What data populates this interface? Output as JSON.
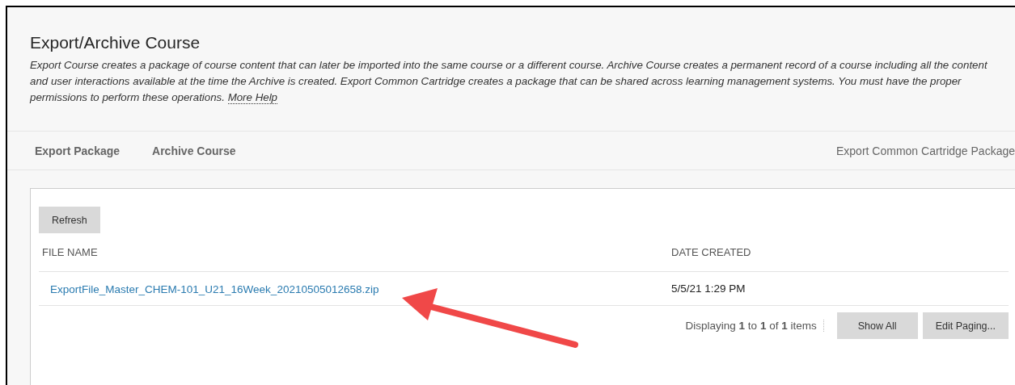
{
  "page": {
    "title": "Export/Archive Course",
    "description": "*Export Course creates a package of course content that can later be imported into the same course or a different course. Archive Course creates a permanent record of a course including all the content and user interactions available at the time the Archive is created. Export Common Cartridge creates a package that can be shared across learning management systems. You must have the proper permissions to perform these operations.*",
    "help_link": "More Help"
  },
  "action_bar": [
    {
      "label": "Export Package",
      "kind": "primary"
    },
    {
      "label": "Archive Course",
      "kind": "primary"
    },
    {
      "label": "Export Common Cartridge Package",
      "kind": "secondary"
    }
  ],
  "refresh_button": "Refresh",
  "table": {
    "columns": [
      "FILE NAME",
      "DATE CREATED"
    ],
    "rows": [
      {
        "file_name": "ExportFile_Master_CHEM-101_U21_16Week_20210505012658.zip",
        "date_created": "5/5/21 1:29 PM"
      }
    ]
  },
  "pagination": {
    "summary": "Displaying **1** to **1** of **1** items",
    "buttons": [
      "Show All",
      "Edit Paging..."
    ]
  }
}
